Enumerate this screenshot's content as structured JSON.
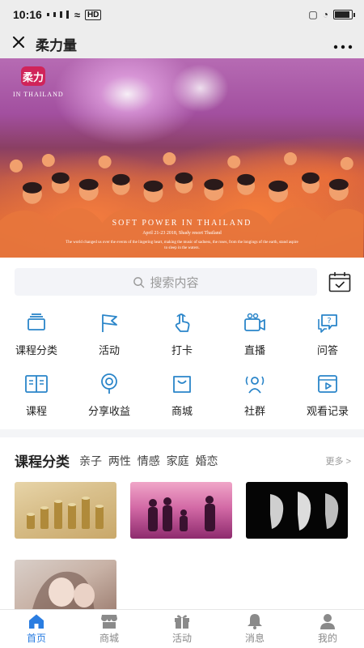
{
  "status": {
    "time": "10:16",
    "network": "HD"
  },
  "titlebar": {
    "title": "柔力量",
    "close_icon": "close-icon",
    "more_icon": "more-icon"
  },
  "banner": {
    "logo_mark": "柔力",
    "logo_sub": "IN THAILAND",
    "headline": "SOFT POWER IN THAILAND",
    "date": "April 21-23 2018, Shady resort Thailand",
    "caption": "The world changed us over the events of the lingering heart, making the music of sadness, the roses, from the longings of the earth, stand aspire to sleep in the waters."
  },
  "search": {
    "placeholder": "搜索内容"
  },
  "grid": [
    {
      "label": "课程分类",
      "icon": "category-icon"
    },
    {
      "label": "活动",
      "icon": "flag-icon"
    },
    {
      "label": "打卡",
      "icon": "tap-icon"
    },
    {
      "label": "直播",
      "icon": "live-camera-icon"
    },
    {
      "label": "问答",
      "icon": "qa-icon"
    },
    {
      "label": "课程",
      "icon": "book-icon"
    },
    {
      "label": "分享收益",
      "icon": "share-earn-icon"
    },
    {
      "label": "商城",
      "icon": "shop-bag-icon"
    },
    {
      "label": "社群",
      "icon": "community-icon"
    },
    {
      "label": "观看记录",
      "icon": "history-icon"
    }
  ],
  "category": {
    "heading": "课程分类",
    "tags": [
      "亲子",
      "两性",
      "情感",
      "家庭",
      "婚恋"
    ],
    "more": "更多 >"
  },
  "tabbar": [
    {
      "label": "首页",
      "icon": "home-icon",
      "active": true
    },
    {
      "label": "商城",
      "icon": "store-icon",
      "active": false
    },
    {
      "label": "活动",
      "icon": "gift-icon",
      "active": false
    },
    {
      "label": "消息",
      "icon": "bell-icon",
      "active": false
    },
    {
      "label": "我的",
      "icon": "profile-icon",
      "active": false
    }
  ],
  "colors": {
    "accent": "#2a7de1",
    "icon": "#2a85c9",
    "bg_header": "#ededed"
  }
}
